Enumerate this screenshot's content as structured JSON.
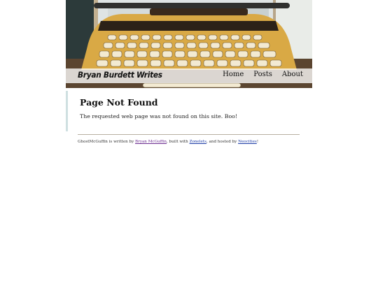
{
  "header": {
    "brand": "Bryan Burdett Writes",
    "nav": [
      "Home",
      "Posts",
      "About"
    ],
    "banner_image": "typewriter-photo"
  },
  "main": {
    "title": "Page Not Found",
    "message": "The requested web page was not found on this site. Boo!"
  },
  "footer": {
    "prefix": "GhostMcGuffin is written by ",
    "author_link": "Bryan McGuffin",
    "mid1": ", built with ",
    "builder_link": "Zonelets",
    "mid2": ", and hosted by ",
    "host_link": "Neocities",
    "suffix": "!"
  },
  "colors": {
    "accent_border": "#cfe0e1",
    "link": "#1a3aa5",
    "visited_link": "#6a2b8f"
  }
}
